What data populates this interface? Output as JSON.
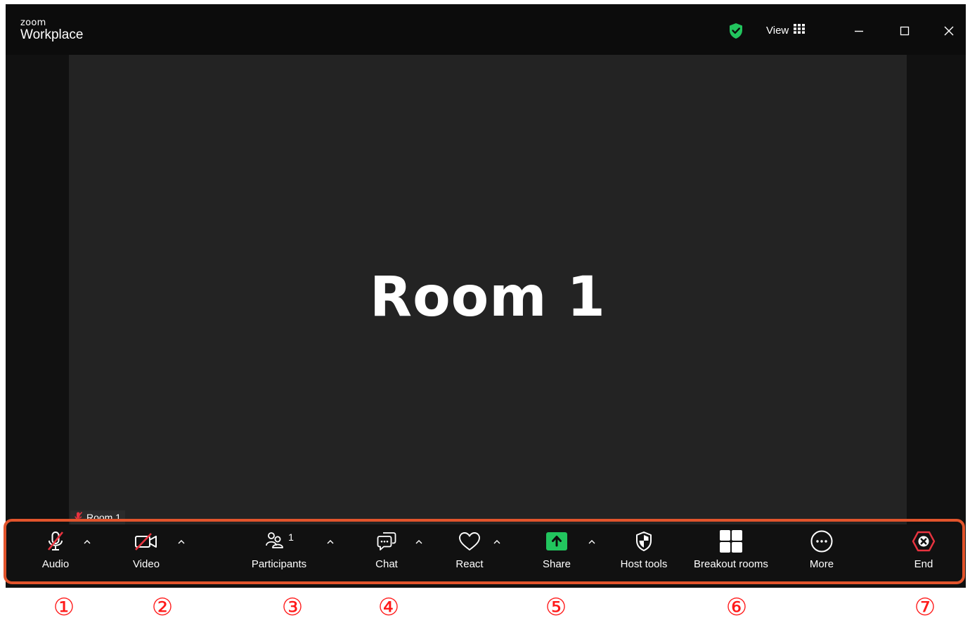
{
  "app": {
    "brand_small": "zoom",
    "brand_name": "Workplace"
  },
  "titlebar": {
    "view_label": "View"
  },
  "meeting": {
    "room_title": "Room 1",
    "participant_name": "Room 1"
  },
  "toolbar": {
    "audio": "Audio",
    "video": "Video",
    "participants": "Participants",
    "participants_count": "1",
    "chat": "Chat",
    "react": "React",
    "share": "Share",
    "host_tools": "Host tools",
    "breakout_rooms": "Breakout rooms",
    "more": "More",
    "end": "End"
  },
  "callouts": [
    "①",
    "②",
    "③",
    "④",
    "⑤",
    "⑥",
    "⑦"
  ],
  "colors": {
    "accent_green": "#22c55e",
    "mute_red": "#e8333f",
    "end_red": "#e8333f",
    "annotation": "#e2542c",
    "callout": "#ff1a1a"
  },
  "icons": {
    "security": "shield-check-icon",
    "view": "grid-icon",
    "audio": "mic-muted-icon",
    "video": "video-off-icon",
    "participants": "people-icon",
    "chat": "chat-icon",
    "react": "heart-icon",
    "share": "share-up-arrow-icon",
    "host_tools": "shield-icon",
    "breakout": "four-squares-icon",
    "more": "ellipsis-circle-icon",
    "end": "end-x-icon"
  }
}
